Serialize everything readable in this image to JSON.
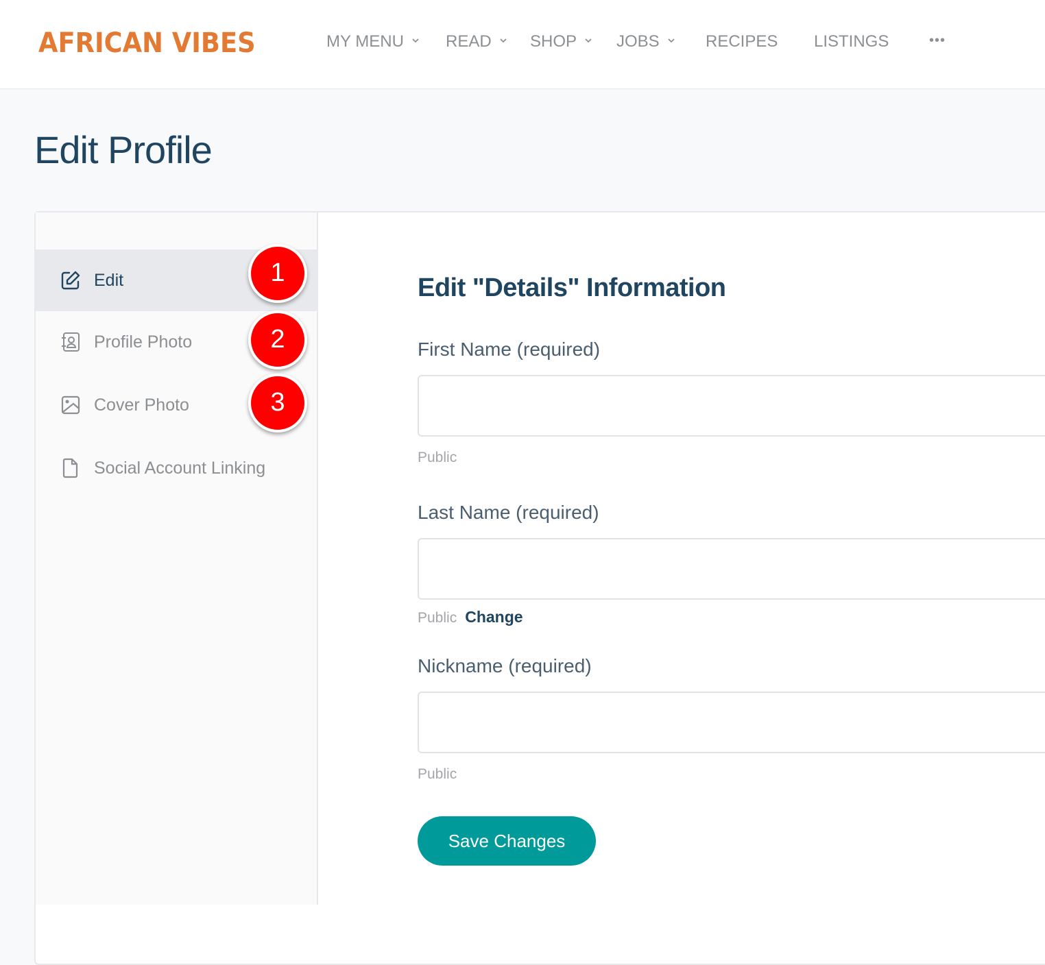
{
  "header": {
    "logo_text": "AFRICAN VIBES",
    "logo_color": "#e37a33",
    "nav": [
      {
        "label": "MY MENU",
        "has_dropdown": true
      },
      {
        "label": "READ",
        "has_dropdown": true
      },
      {
        "label": "SHOP",
        "has_dropdown": true
      },
      {
        "label": "JOBS",
        "has_dropdown": true
      },
      {
        "label": "RECIPES",
        "has_dropdown": false
      },
      {
        "label": "LISTINGS",
        "has_dropdown": false
      },
      {
        "label": "•••",
        "icon": "more-horizontal-icon"
      }
    ]
  },
  "page": {
    "title": "Edit Profile"
  },
  "sidebar": {
    "items": [
      {
        "label": "Edit",
        "icon": "edit-icon",
        "active": true
      },
      {
        "label": "Profile Photo",
        "icon": "contact-book-icon",
        "active": false
      },
      {
        "label": "Cover Photo",
        "icon": "image-icon",
        "active": false
      },
      {
        "label": "Social Account Linking",
        "icon": "file-icon",
        "active": false
      }
    ]
  },
  "annotations": [
    {
      "number": "1",
      "color": "#ff0000"
    },
    {
      "number": "2",
      "color": "#ff0000"
    },
    {
      "number": "3",
      "color": "#ff0000"
    }
  ],
  "form": {
    "title": "Edit \"Details\" Information",
    "fields": [
      {
        "label": "First Name (required)",
        "value": "",
        "visibility": "Public",
        "change_label": null
      },
      {
        "label": "Last Name (required)",
        "value": "",
        "visibility": "Public",
        "change_label": "Change"
      },
      {
        "label": "Nickname (required)",
        "value": "",
        "visibility": "Public",
        "change_label": null
      }
    ],
    "save_label": "Save Changes",
    "accent_color": "#009a9b",
    "heading_color": "#1f4560"
  }
}
